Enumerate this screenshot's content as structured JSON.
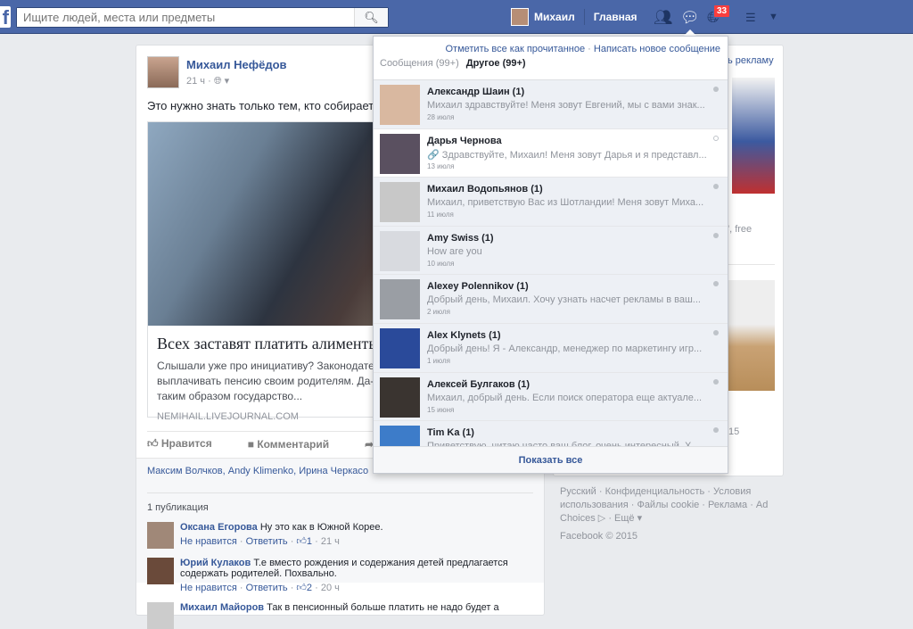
{
  "topbar": {
    "logo": "f",
    "search_placeholder": "Ищите людей, места или предметы",
    "user_name": "Михаил",
    "home_label": "Главная",
    "notifications_count": "33"
  },
  "post": {
    "author": "Михаил Нефёдов",
    "time": "21 ч ·",
    "text": "Это нужно знать только тем, кто собирает",
    "link": {
      "title": "Всех заставят платить алименты",
      "desc": [
        "Слышали уже про инициативу? Законодатели",
        "выплачивать пенсию своим родителям. Да-да,",
        "таким образом государство..."
      ],
      "domain": "NEMIHAIL.LIVEJOURNAL.COM"
    },
    "actions": {
      "like": "Нравится",
      "comment": "Комментарий",
      "share": "П"
    },
    "likers": "Максим Волчков, Andy Klimenko, Ирина Черкасо",
    "comment_count": "1 публикация",
    "comments": [
      {
        "name": "Оксана Егорова",
        "text": "Ну это как в Южной Корее.",
        "unlike": "Не нравится",
        "reply": "Ответить",
        "likes": "1",
        "time": "21 ч"
      },
      {
        "name": "Юрий Кулаков",
        "text": "Т.е вместо рождения и содержания детей предлагается содержать родителей. Похвально.",
        "unlike": "Не нравится",
        "reply": "Ответить",
        "likes": "2",
        "time": "20 ч"
      },
      {
        "name": "Михаил Майоров",
        "text": "Так в пенсионный больше платить не надо будет а",
        "unlike": "",
        "reply": "",
        "likes": "",
        "time": ""
      }
    ]
  },
  "side": {
    "ad_text": "ь рекламу",
    "free_text": "', free",
    "year_frag": "15"
  },
  "footer": {
    "links": "Русский · Конфиденциальность · Условия использования · Файлы cookie · Реклама · Ad Choices ▷ · Ещё ▾",
    "copyright": "Facebook © 2015"
  },
  "messages": {
    "mark_read": "Отметить все как прочитанное",
    "new_message": "Написать новое сообщение",
    "tab_inbox": "Сообщения (99+)",
    "tab_other": "Другое (99+)",
    "show_all": "Показать все",
    "items": [
      {
        "name": "Александр Шаин (1)",
        "text": "Михаил здравствуйте! Меня зовут Евгений, мы с вами знак...",
        "date": "28 июля",
        "color": "#d9b8a0"
      },
      {
        "name": "Дарья Чернова",
        "text": "🔗 Здравствуйте, Михаил! Меня зовут Дарья и я представл...",
        "date": "13 июля",
        "color": "#5a5060"
      },
      {
        "name": "Михаил Водопьянов (1)",
        "text": "Михаил, приветствую Вас из Шотландии! Меня зовут Миха...",
        "date": "11 июля",
        "color": "#c8c8c8"
      },
      {
        "name": "Amy Swiss (1)",
        "text": "How are you",
        "date": "10 июля",
        "color": "#d8dadf"
      },
      {
        "name": "Alexey Polennikov (1)",
        "text": "Добрый день, Михаил. Хочу узнать насчет рекламы в ваш...",
        "date": "2 июля",
        "color": "#9a9ea4"
      },
      {
        "name": "Alex Klynets (1)",
        "text": "Добрый день! Я - Александр, менеджер по маркетингу игр...",
        "date": "1 июля",
        "color": "#2a4a9a"
      },
      {
        "name": "Алексей Булгаков (1)",
        "text": "Михаил, добрый день. Если поиск оператора еще актуале...",
        "date": "15 июня",
        "color": "#3a3430"
      },
      {
        "name": "Tim Ka (1)",
        "text": "Приветствую, читаю часто ваш блог, очень интересный. Х...",
        "date": "",
        "color": "#3d7cc9"
      }
    ]
  }
}
